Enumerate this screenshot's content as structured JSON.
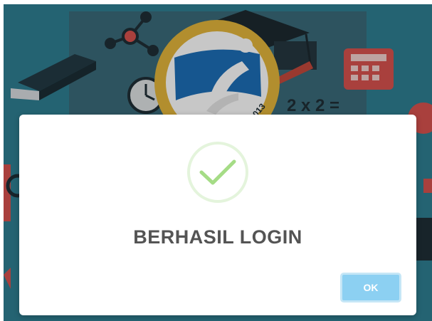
{
  "background": {
    "equation_text": "2 x 2 =",
    "logo_badge_text": "2013",
    "colors": {
      "base": "#2f7f93",
      "panel": "#3c6f7f",
      "logo_ring": "#e5b73b",
      "logo_blue": "#1d6fb8",
      "calculator": "#d9534f"
    }
  },
  "dialog": {
    "icon": "success-checkmark-icon",
    "title": "BERHASIL LOGIN",
    "ok_label": "OK",
    "colors": {
      "check": "#a5dc86",
      "ok_button": "#8cd0f2",
      "title": "#545454"
    }
  }
}
